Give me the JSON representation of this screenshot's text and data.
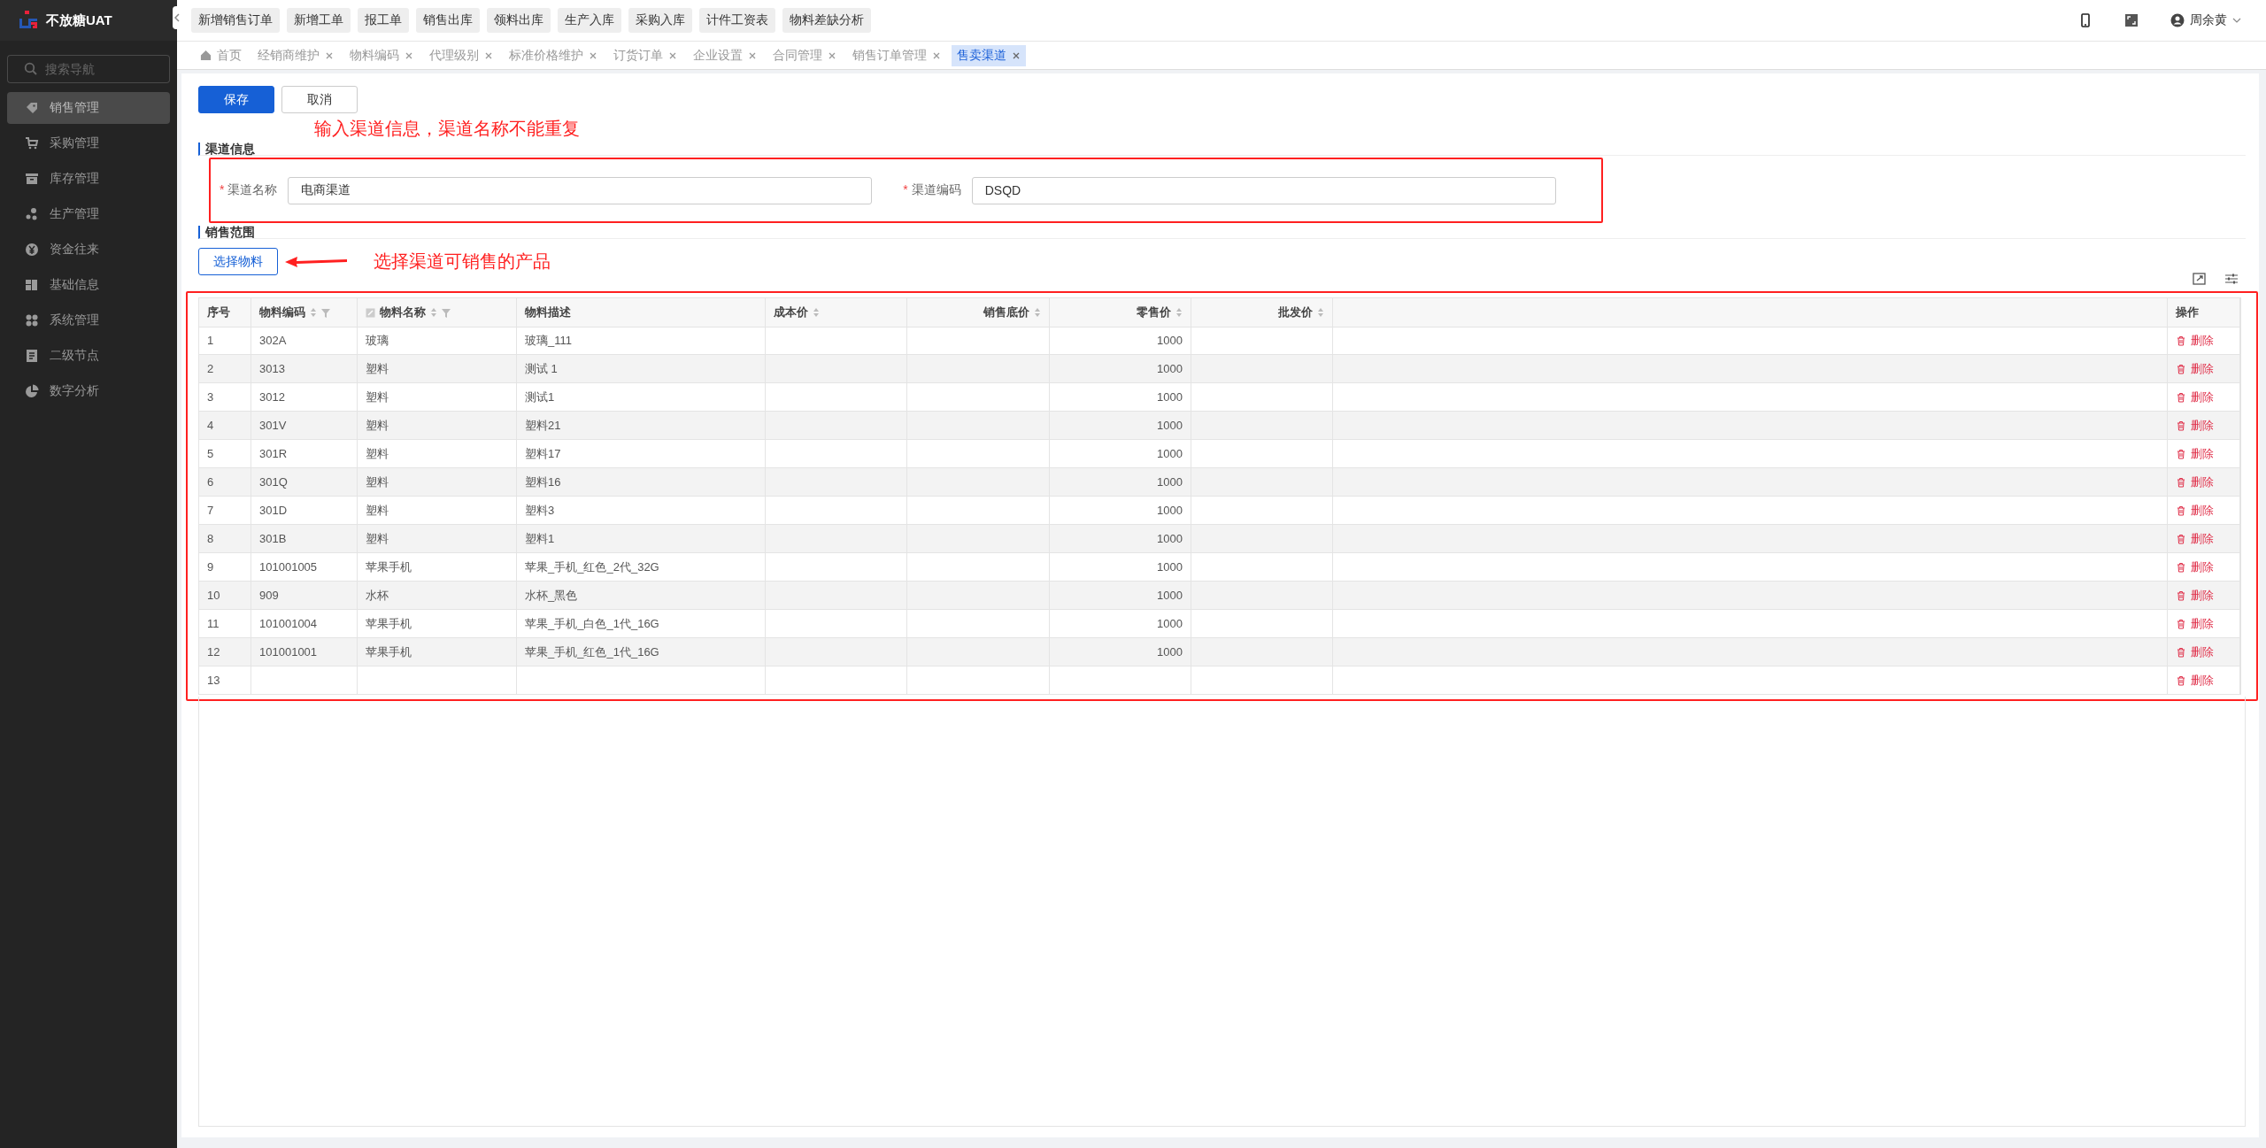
{
  "app": {
    "title": "不放糖UAT"
  },
  "sidebar": {
    "search": {
      "placeholder": "搜索导航"
    },
    "items": [
      {
        "label": "销售管理",
        "selected": true
      },
      {
        "label": "采购管理",
        "selected": false
      },
      {
        "label": "库存管理",
        "selected": false
      },
      {
        "label": "生产管理",
        "selected": false
      },
      {
        "label": "资金往来",
        "selected": false
      },
      {
        "label": "基础信息",
        "selected": false
      },
      {
        "label": "系统管理",
        "selected": false
      },
      {
        "label": "二级节点",
        "selected": false
      },
      {
        "label": "数字分析",
        "selected": false
      }
    ]
  },
  "quick_actions": [
    "新增销售订单",
    "新增工单",
    "报工单",
    "销售出库",
    "领料出库",
    "生产入库",
    "采购入库",
    "计件工资表",
    "物料差缺分析"
  ],
  "user": {
    "name": "周余黄"
  },
  "tabs": [
    {
      "label": "首页",
      "closable": false,
      "selected": false
    },
    {
      "label": "经销商维护",
      "closable": true,
      "selected": false
    },
    {
      "label": "物料编码",
      "closable": true,
      "selected": false
    },
    {
      "label": "代理级别",
      "closable": true,
      "selected": false
    },
    {
      "label": "标准价格维护",
      "closable": true,
      "selected": false
    },
    {
      "label": "订货订单",
      "closable": true,
      "selected": false
    },
    {
      "label": "企业设置",
      "closable": true,
      "selected": false
    },
    {
      "label": "合同管理",
      "closable": true,
      "selected": false
    },
    {
      "label": "销售订单管理",
      "closable": true,
      "selected": false
    },
    {
      "label": "售卖渠道",
      "closable": true,
      "selected": true
    }
  ],
  "buttons": {
    "save": "保存",
    "cancel": "取消"
  },
  "sections": {
    "info": "渠道信息",
    "scope": "销售范围"
  },
  "form": [
    {
      "required_mark": "*",
      "label": "渠道名称",
      "value": "电商渠道"
    },
    {
      "required_mark": "*",
      "label": "渠道编码",
      "value": "DSQD"
    }
  ],
  "select_button": "选择物料",
  "annotations": [
    "输入渠道信息，渠道名称不能重复",
    "选择渠道可销售的产品"
  ],
  "table": {
    "columns": [
      {
        "label": "序号",
        "sortable": false,
        "filterable": false,
        "editable": false
      },
      {
        "label": "物料编码",
        "sortable": true,
        "filterable": true,
        "editable": false
      },
      {
        "label": "物料名称",
        "sortable": true,
        "filterable": true,
        "editable": true
      },
      {
        "label": "物料描述",
        "sortable": false,
        "filterable": false,
        "editable": false
      },
      {
        "label": "成本价",
        "sortable": true,
        "filterable": false,
        "editable": false
      },
      {
        "label": "销售底价",
        "sortable": true,
        "filterable": false,
        "editable": false
      },
      {
        "label": "零售价",
        "sortable": true,
        "filterable": false,
        "editable": false
      },
      {
        "label": "批发价",
        "sortable": true,
        "filterable": false,
        "editable": false
      },
      {
        "label": "操作",
        "sortable": false,
        "filterable": false,
        "editable": false
      }
    ],
    "rows": [
      {
        "no": "1",
        "code": "302A",
        "name": "玻璃",
        "description": "玻璃_111",
        "retail_price": "1000",
        "action": "删除"
      },
      {
        "no": "2",
        "code": "3013",
        "name": "塑料",
        "description": "测试 1",
        "retail_price": "1000",
        "action": "删除"
      },
      {
        "no": "3",
        "code": "3012",
        "name": "塑料",
        "description": "测试1",
        "retail_price": "1000",
        "action": "删除"
      },
      {
        "no": "4",
        "code": "301V",
        "name": "塑料",
        "description": "塑料21",
        "retail_price": "1000",
        "action": "删除"
      },
      {
        "no": "5",
        "code": "301R",
        "name": "塑料",
        "description": "塑料17",
        "retail_price": "1000",
        "action": "删除"
      },
      {
        "no": "6",
        "code": "301Q",
        "name": "塑料",
        "description": "塑料16",
        "retail_price": "1000",
        "action": "删除"
      },
      {
        "no": "7",
        "code": "301D",
        "name": "塑料",
        "description": "塑料3",
        "retail_price": "1000",
        "action": "删除"
      },
      {
        "no": "8",
        "code": "301B",
        "name": "塑料",
        "description": "塑料1",
        "retail_price": "1000",
        "action": "删除"
      },
      {
        "no": "9",
        "code": "101001005",
        "name": "苹果手机",
        "description": "苹果_手机_红色_2代_32G",
        "retail_price": "1000",
        "action": "删除"
      },
      {
        "no": "10",
        "code": "909",
        "name": "水杯",
        "description": "水杯_黑色",
        "retail_price": "1000",
        "action": "删除"
      },
      {
        "no": "11",
        "code": "101001004",
        "name": "苹果手机",
        "description": "苹果_手机_白色_1代_16G",
        "retail_price": "1000",
        "action": "删除"
      },
      {
        "no": "12",
        "code": "101001001",
        "name": "苹果手机",
        "description": "苹果_手机_红色_1代_16G",
        "retail_price": "1000",
        "action": "删除"
      },
      {
        "no": "13",
        "action": "删除"
      }
    ]
  }
}
